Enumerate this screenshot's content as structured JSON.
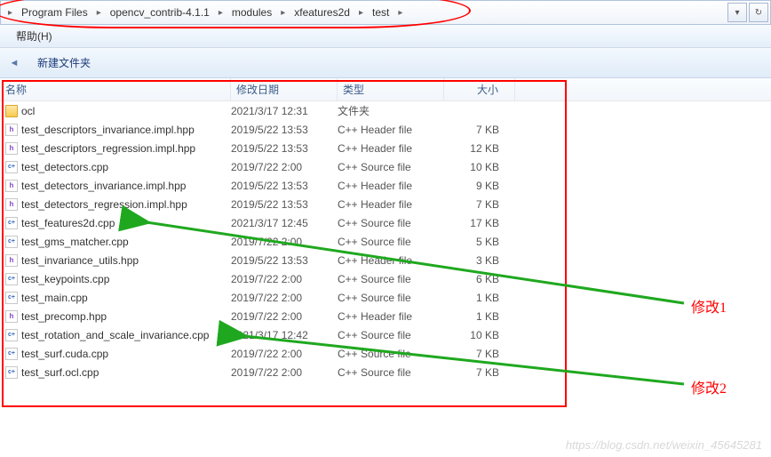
{
  "breadcrumbs": [
    "Program Files",
    "opencv_contrib-4.1.1",
    "modules",
    "xfeatures2d",
    "test"
  ],
  "toolbar": {
    "help": "帮助(H)"
  },
  "subbar": {
    "newfolder": "新建文件夹"
  },
  "headers": {
    "name": "名称",
    "date": "修改日期",
    "type": "类型",
    "size": "大小"
  },
  "files": [
    {
      "icon": "folder",
      "name": "ocl",
      "date": "2021/3/17 12:31",
      "type": "文件夹",
      "size": ""
    },
    {
      "icon": "h",
      "name": "test_descriptors_invariance.impl.hpp",
      "date": "2019/5/22 13:53",
      "type": "C++ Header file",
      "size": "7 KB"
    },
    {
      "icon": "h",
      "name": "test_descriptors_regression.impl.hpp",
      "date": "2019/5/22 13:53",
      "type": "C++ Header file",
      "size": "12 KB"
    },
    {
      "icon": "cpp",
      "name": "test_detectors.cpp",
      "date": "2019/7/22 2:00",
      "type": "C++ Source file",
      "size": "10 KB"
    },
    {
      "icon": "h",
      "name": "test_detectors_invariance.impl.hpp",
      "date": "2019/5/22 13:53",
      "type": "C++ Header file",
      "size": "9 KB"
    },
    {
      "icon": "h",
      "name": "test_detectors_regression.impl.hpp",
      "date": "2019/5/22 13:53",
      "type": "C++ Header file",
      "size": "7 KB"
    },
    {
      "icon": "cpp",
      "name": "test_features2d.cpp",
      "date": "2021/3/17 12:45",
      "type": "C++ Source file",
      "size": "17 KB"
    },
    {
      "icon": "cpp",
      "name": "test_gms_matcher.cpp",
      "date": "2019/7/22 2:00",
      "type": "C++ Source file",
      "size": "5 KB"
    },
    {
      "icon": "h",
      "name": "test_invariance_utils.hpp",
      "date": "2019/5/22 13:53",
      "type": "C++ Header file",
      "size": "3 KB"
    },
    {
      "icon": "cpp",
      "name": "test_keypoints.cpp",
      "date": "2019/7/22 2:00",
      "type": "C++ Source file",
      "size": "6 KB"
    },
    {
      "icon": "cpp",
      "name": "test_main.cpp",
      "date": "2019/7/22 2:00",
      "type": "C++ Source file",
      "size": "1 KB"
    },
    {
      "icon": "h",
      "name": "test_precomp.hpp",
      "date": "2019/7/22 2:00",
      "type": "C++ Header file",
      "size": "1 KB"
    },
    {
      "icon": "cpp",
      "name": "test_rotation_and_scale_invariance.cpp",
      "date": "2021/3/17 12:42",
      "type": "C++ Source file",
      "size": "10 KB"
    },
    {
      "icon": "cpp",
      "name": "test_surf.cuda.cpp",
      "date": "2019/7/22 2:00",
      "type": "C++ Source file",
      "size": "7 KB"
    },
    {
      "icon": "cpp",
      "name": "test_surf.ocl.cpp",
      "date": "2019/7/22 2:00",
      "type": "C++ Source file",
      "size": "7 KB"
    }
  ],
  "annotations": {
    "a1": "修改1",
    "a2": "修改2"
  },
  "watermark": "https://blog.csdn.net/weixin_45645281"
}
